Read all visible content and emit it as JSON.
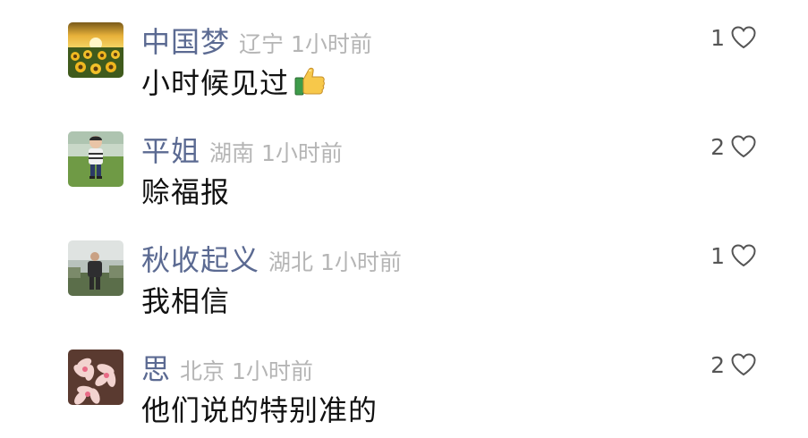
{
  "comments": [
    {
      "user": "中国梦",
      "location": "辽宁",
      "time": "1小时前",
      "text": "小时候见过",
      "emoji": "thumbs-up-icon",
      "likes": "1",
      "avatar": "sunflower-field-avatar"
    },
    {
      "user": "平姐",
      "location": "湖南",
      "time": "1小时前",
      "text": "赊福报",
      "likes": "2",
      "avatar": "child-on-grass-avatar"
    },
    {
      "user": "秋收起义",
      "location": "湖北",
      "time": "1小时前",
      "text": "我相信",
      "likes": "1",
      "avatar": "man-in-field-avatar"
    },
    {
      "user": "思",
      "location": "北京",
      "time": "1小时前",
      "text": "他们说的特别准的",
      "likes": "2",
      "avatar": "pink-flowers-avatar"
    }
  ],
  "colors": {
    "username": "#5b6a92",
    "meta": "#b5b5b5",
    "text": "#111111",
    "like_count": "#555555"
  }
}
